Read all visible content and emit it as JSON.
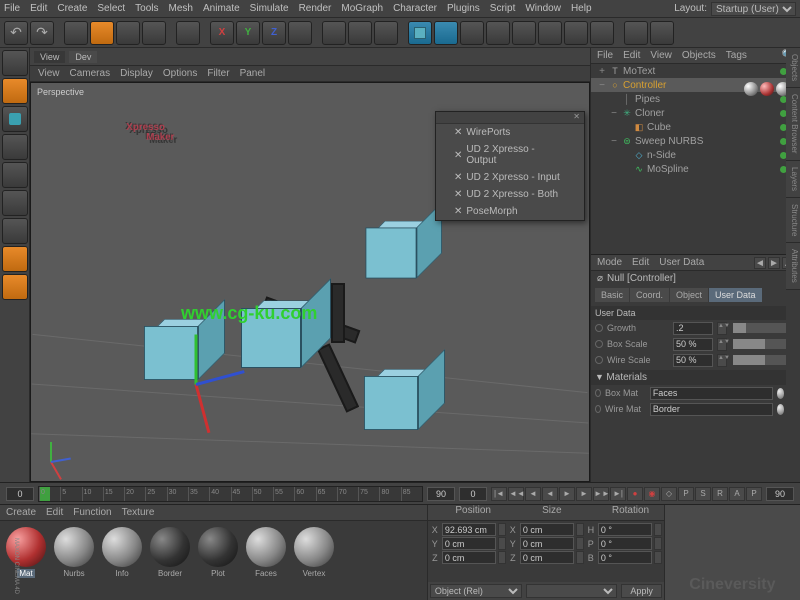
{
  "menubar": {
    "items": [
      "File",
      "Edit",
      "Create",
      "Select",
      "Tools",
      "Mesh",
      "Animate",
      "Simulate",
      "Render",
      "MoGraph",
      "Character",
      "Plugins",
      "Script",
      "Window",
      "Help"
    ],
    "layout_label": "Layout:",
    "layout_value": "Startup (User)"
  },
  "view_tabs": [
    "View",
    "Dev"
  ],
  "view_submenu": [
    "View",
    "Cameras",
    "Display",
    "Options",
    "Filter",
    "Panel"
  ],
  "viewport": {
    "perspective_label": "Perspective",
    "big_text_line1": "Xpresso",
    "big_text_line2": "Maker",
    "watermark_url": "www.cg-ku.com"
  },
  "context_menu": {
    "items": [
      "WirePorts",
      "UD 2 Xpresso - Output",
      "UD 2 Xpresso - Input",
      "UD 2 Xpresso - Both",
      "PoseMorph"
    ]
  },
  "objects_menu": [
    "File",
    "Edit",
    "View",
    "Objects",
    "Tags"
  ],
  "object_tree": [
    {
      "indent": 0,
      "icon": "T",
      "label": "MoText",
      "color": "#a0a0a0",
      "toggle": "+",
      "dots": true
    },
    {
      "indent": 0,
      "icon": "○",
      "label": "Controller",
      "color": "#d8a030",
      "toggle": "−",
      "sel": true,
      "dots": true
    },
    {
      "indent": 1,
      "icon": "│",
      "label": "Pipes",
      "color": "#808080",
      "toggle": "",
      "dots": true
    },
    {
      "indent": 1,
      "icon": "✳",
      "label": "Cloner",
      "color": "#40b080",
      "toggle": "−",
      "dots": true
    },
    {
      "indent": 2,
      "icon": "◧",
      "label": "Cube",
      "color": "#d08a40",
      "toggle": "",
      "dots": true
    },
    {
      "indent": 1,
      "icon": "⊜",
      "label": "Sweep NURBS",
      "color": "#40c060",
      "toggle": "−",
      "dots": true
    },
    {
      "indent": 2,
      "icon": "◇",
      "label": "n-Side",
      "color": "#50b0d0",
      "toggle": "",
      "dots": true
    },
    {
      "indent": 2,
      "icon": "∿",
      "label": "MoSpline",
      "color": "#40c060",
      "toggle": "",
      "dots": true
    }
  ],
  "attributes": {
    "menu": [
      "Mode",
      "Edit",
      "User Data"
    ],
    "title_icon": "⌀",
    "title": "Null [Controller]",
    "tabs": [
      "Basic",
      "Coord.",
      "Object",
      "User Data"
    ],
    "active_tab": "User Data",
    "section1": "User Data",
    "rows": [
      {
        "label": "Growth",
        "value": ".2",
        "slider": 20
      },
      {
        "label": "Box Scale",
        "value": "50 %",
        "slider": 50
      },
      {
        "label": "Wire Scale",
        "value": "50 %",
        "slider": 50
      }
    ],
    "section2": "Materials",
    "mat_rows": [
      {
        "label": "Box Mat",
        "value": "Faces"
      },
      {
        "label": "Wire Mat",
        "value": "Border"
      }
    ]
  },
  "timeline": {
    "start": "0",
    "end": "90",
    "ticks": [
      "0",
      "5",
      "10",
      "15",
      "20",
      "25",
      "30",
      "35",
      "40",
      "45",
      "50",
      "55",
      "60",
      "65",
      "70",
      "75",
      "80",
      "85",
      "90"
    ]
  },
  "materials": {
    "menu": [
      "Create",
      "Edit",
      "Function",
      "Texture"
    ],
    "items": [
      {
        "name": "Mat",
        "cls": "mat-red",
        "sel": true
      },
      {
        "name": "Nurbs",
        "cls": "mat-grey"
      },
      {
        "name": "Info",
        "cls": "mat-grey"
      },
      {
        "name": "Border",
        "cls": "mat-dark"
      },
      {
        "name": "Plot",
        "cls": "mat-dark"
      },
      {
        "name": "Faces",
        "cls": "mat-grey"
      },
      {
        "name": "Vertex",
        "cls": "mat-grey"
      }
    ]
  },
  "coords": {
    "headers": [
      "Position",
      "Size",
      "Rotation"
    ],
    "rows": [
      {
        "axis": "X",
        "pos": "92.693 cm",
        "size": "0 cm",
        "rot": "0 °",
        "rlabel": "H"
      },
      {
        "axis": "Y",
        "pos": "0 cm",
        "size": "0 cm",
        "rot": "0 °",
        "rlabel": "P"
      },
      {
        "axis": "Z",
        "pos": "0 cm",
        "size": "0 cm",
        "rot": "0 °",
        "rlabel": "B"
      }
    ],
    "mode": "Object (Rel)",
    "apply": "Apply"
  },
  "right_strip": [
    "Objects",
    "Content Browser",
    "Layers",
    "Structure",
    "Attributes"
  ],
  "logo": "Cineversity",
  "maxon": "MAXON CINEMA 4D"
}
